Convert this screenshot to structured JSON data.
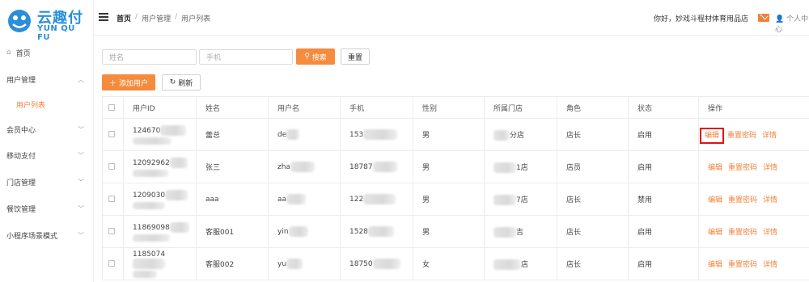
{
  "logo": {
    "cn": "云趣付",
    "en": "YUN QU FU"
  },
  "sidebar": {
    "items": [
      {
        "label": "首页",
        "icon": "home-icon"
      },
      {
        "label": "用户管理",
        "icon": "chevron-up-icon"
      },
      {
        "label": "用户列表"
      },
      {
        "label": "会员中心",
        "icon": "chevron-down-icon"
      },
      {
        "label": "移动支付",
        "icon": "chevron-down-icon"
      },
      {
        "label": "门店管理",
        "icon": "chevron-down-icon"
      },
      {
        "label": "餐饮管理",
        "icon": "chevron-down-icon"
      },
      {
        "label": "小程序场景模式",
        "icon": "chevron-down-icon"
      }
    ]
  },
  "header": {
    "breadcrumb": [
      "首页",
      "用户管理",
      "用户列表"
    ],
    "greeting": "你好，妙戏斗程材体育用品店",
    "user_center": "个人中心"
  },
  "search": {
    "name_placeholder": "姓名",
    "phone_placeholder": "手机",
    "search_label": "搜索",
    "reset_label": "重置"
  },
  "toolbar": {
    "add_label": "添加用户",
    "refresh_label": "刷新"
  },
  "table": {
    "columns": [
      "用户ID",
      "姓名",
      "用户名",
      "手机",
      "性别",
      "所属门店",
      "角色",
      "状态",
      "操作"
    ],
    "rows": [
      {
        "id": "124670",
        "name": "蕾总",
        "username": "de",
        "phone": "153",
        "gender": "男",
        "store": "分店",
        "role": "店长",
        "status": "启用"
      },
      {
        "id": "12092962",
        "name": "张三",
        "username": "zha",
        "phone": "18787",
        "gender": "男",
        "store": "1店",
        "role": "店员",
        "status": "启用"
      },
      {
        "id": "1209030",
        "name": "aaa",
        "username": "aa",
        "phone": "122",
        "gender": "男",
        "store": "7店",
        "role": "店长",
        "status": "禁用"
      },
      {
        "id": "11869098",
        "name": "客服001",
        "username": "yin",
        "phone": "1528",
        "gender": "男",
        "store": "吉",
        "role": "店长",
        "status": "启用"
      },
      {
        "id": "1185074",
        "name": "客服002",
        "username": "yu",
        "phone": "18750",
        "gender": "女",
        "store": "店",
        "role": "店长",
        "status": "启用"
      }
    ],
    "actions": {
      "edit": "编辑",
      "reset_pwd": "重置密码",
      "detail": "详情"
    }
  },
  "colors": {
    "accent": "#f58b3c",
    "brand": "#2a8fd8",
    "highlight": "#e01414"
  }
}
